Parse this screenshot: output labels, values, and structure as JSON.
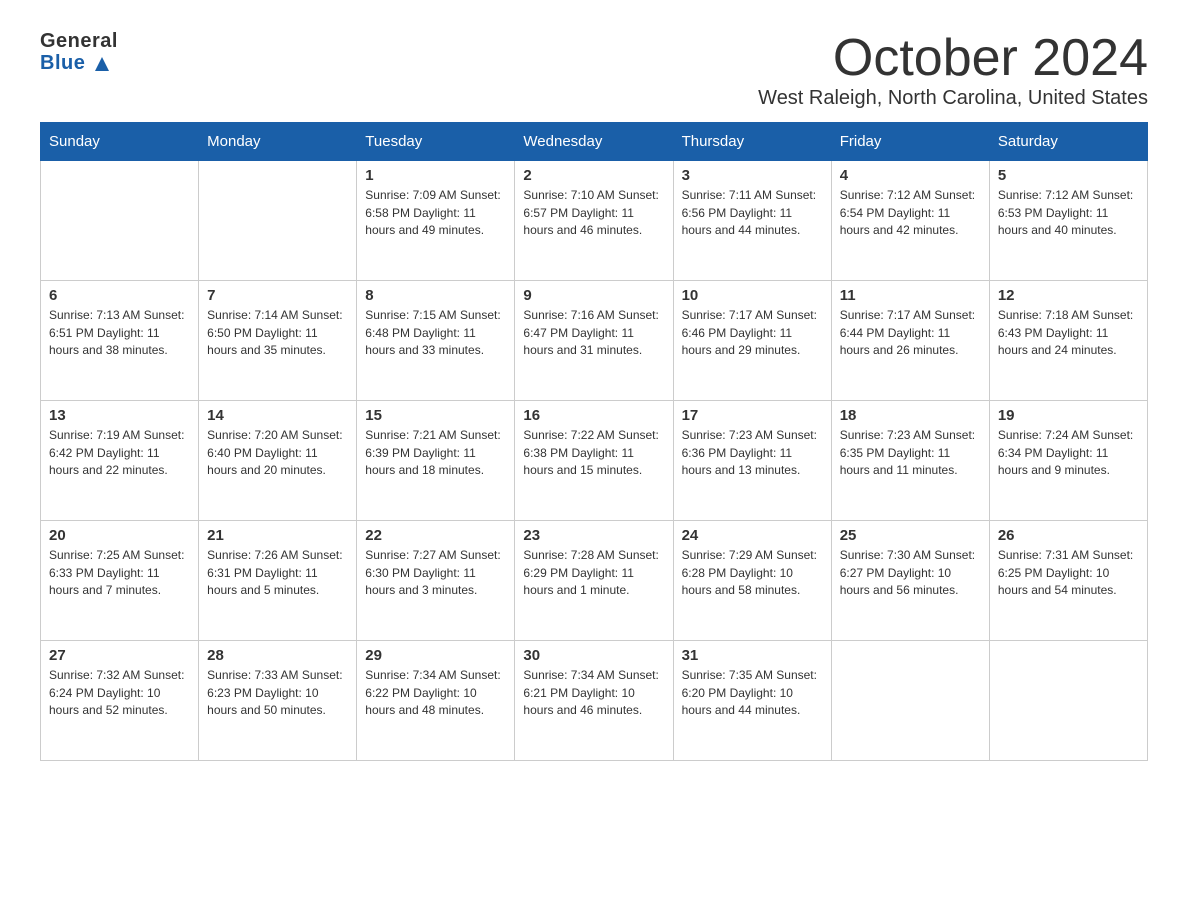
{
  "header": {
    "logo_line1": "General",
    "logo_line2": "Blue",
    "month_title": "October 2024",
    "location": "West Raleigh, North Carolina, United States"
  },
  "calendar": {
    "days_of_week": [
      "Sunday",
      "Monday",
      "Tuesday",
      "Wednesday",
      "Thursday",
      "Friday",
      "Saturday"
    ],
    "weeks": [
      [
        {
          "day": "",
          "info": ""
        },
        {
          "day": "",
          "info": ""
        },
        {
          "day": "1",
          "info": "Sunrise: 7:09 AM\nSunset: 6:58 PM\nDaylight: 11 hours\nand 49 minutes."
        },
        {
          "day": "2",
          "info": "Sunrise: 7:10 AM\nSunset: 6:57 PM\nDaylight: 11 hours\nand 46 minutes."
        },
        {
          "day": "3",
          "info": "Sunrise: 7:11 AM\nSunset: 6:56 PM\nDaylight: 11 hours\nand 44 minutes."
        },
        {
          "day": "4",
          "info": "Sunrise: 7:12 AM\nSunset: 6:54 PM\nDaylight: 11 hours\nand 42 minutes."
        },
        {
          "day": "5",
          "info": "Sunrise: 7:12 AM\nSunset: 6:53 PM\nDaylight: 11 hours\nand 40 minutes."
        }
      ],
      [
        {
          "day": "6",
          "info": "Sunrise: 7:13 AM\nSunset: 6:51 PM\nDaylight: 11 hours\nand 38 minutes."
        },
        {
          "day": "7",
          "info": "Sunrise: 7:14 AM\nSunset: 6:50 PM\nDaylight: 11 hours\nand 35 minutes."
        },
        {
          "day": "8",
          "info": "Sunrise: 7:15 AM\nSunset: 6:48 PM\nDaylight: 11 hours\nand 33 minutes."
        },
        {
          "day": "9",
          "info": "Sunrise: 7:16 AM\nSunset: 6:47 PM\nDaylight: 11 hours\nand 31 minutes."
        },
        {
          "day": "10",
          "info": "Sunrise: 7:17 AM\nSunset: 6:46 PM\nDaylight: 11 hours\nand 29 minutes."
        },
        {
          "day": "11",
          "info": "Sunrise: 7:17 AM\nSunset: 6:44 PM\nDaylight: 11 hours\nand 26 minutes."
        },
        {
          "day": "12",
          "info": "Sunrise: 7:18 AM\nSunset: 6:43 PM\nDaylight: 11 hours\nand 24 minutes."
        }
      ],
      [
        {
          "day": "13",
          "info": "Sunrise: 7:19 AM\nSunset: 6:42 PM\nDaylight: 11 hours\nand 22 minutes."
        },
        {
          "day": "14",
          "info": "Sunrise: 7:20 AM\nSunset: 6:40 PM\nDaylight: 11 hours\nand 20 minutes."
        },
        {
          "day": "15",
          "info": "Sunrise: 7:21 AM\nSunset: 6:39 PM\nDaylight: 11 hours\nand 18 minutes."
        },
        {
          "day": "16",
          "info": "Sunrise: 7:22 AM\nSunset: 6:38 PM\nDaylight: 11 hours\nand 15 minutes."
        },
        {
          "day": "17",
          "info": "Sunrise: 7:23 AM\nSunset: 6:36 PM\nDaylight: 11 hours\nand 13 minutes."
        },
        {
          "day": "18",
          "info": "Sunrise: 7:23 AM\nSunset: 6:35 PM\nDaylight: 11 hours\nand 11 minutes."
        },
        {
          "day": "19",
          "info": "Sunrise: 7:24 AM\nSunset: 6:34 PM\nDaylight: 11 hours\nand 9 minutes."
        }
      ],
      [
        {
          "day": "20",
          "info": "Sunrise: 7:25 AM\nSunset: 6:33 PM\nDaylight: 11 hours\nand 7 minutes."
        },
        {
          "day": "21",
          "info": "Sunrise: 7:26 AM\nSunset: 6:31 PM\nDaylight: 11 hours\nand 5 minutes."
        },
        {
          "day": "22",
          "info": "Sunrise: 7:27 AM\nSunset: 6:30 PM\nDaylight: 11 hours\nand 3 minutes."
        },
        {
          "day": "23",
          "info": "Sunrise: 7:28 AM\nSunset: 6:29 PM\nDaylight: 11 hours\nand 1 minute."
        },
        {
          "day": "24",
          "info": "Sunrise: 7:29 AM\nSunset: 6:28 PM\nDaylight: 10 hours\nand 58 minutes."
        },
        {
          "day": "25",
          "info": "Sunrise: 7:30 AM\nSunset: 6:27 PM\nDaylight: 10 hours\nand 56 minutes."
        },
        {
          "day": "26",
          "info": "Sunrise: 7:31 AM\nSunset: 6:25 PM\nDaylight: 10 hours\nand 54 minutes."
        }
      ],
      [
        {
          "day": "27",
          "info": "Sunrise: 7:32 AM\nSunset: 6:24 PM\nDaylight: 10 hours\nand 52 minutes."
        },
        {
          "day": "28",
          "info": "Sunrise: 7:33 AM\nSunset: 6:23 PM\nDaylight: 10 hours\nand 50 minutes."
        },
        {
          "day": "29",
          "info": "Sunrise: 7:34 AM\nSunset: 6:22 PM\nDaylight: 10 hours\nand 48 minutes."
        },
        {
          "day": "30",
          "info": "Sunrise: 7:34 AM\nSunset: 6:21 PM\nDaylight: 10 hours\nand 46 minutes."
        },
        {
          "day": "31",
          "info": "Sunrise: 7:35 AM\nSunset: 6:20 PM\nDaylight: 10 hours\nand 44 minutes."
        },
        {
          "day": "",
          "info": ""
        },
        {
          "day": "",
          "info": ""
        }
      ]
    ]
  }
}
